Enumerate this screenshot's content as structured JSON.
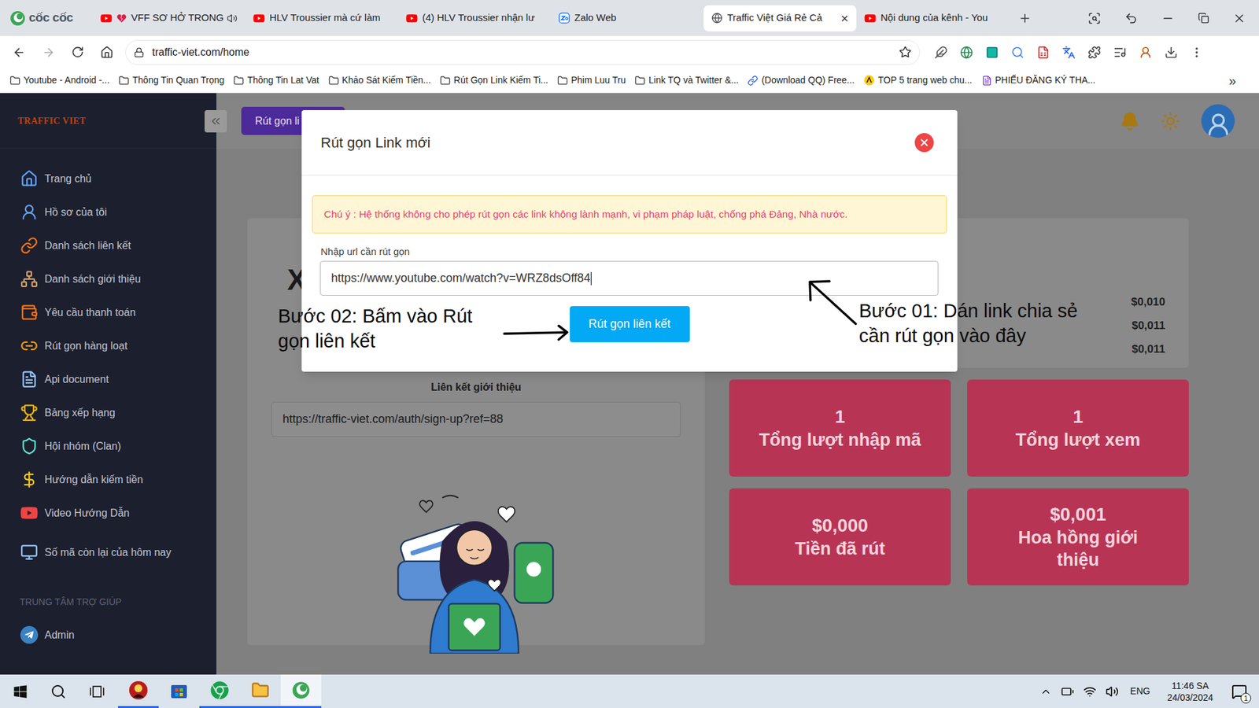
{
  "browser": {
    "brand": "cốc cốc",
    "tabs": [
      {
        "label": "VFF SƠ HỞ TRONG",
        "kind": "youtube",
        "selected": false,
        "audio": true,
        "heart": true
      },
      {
        "label": "HLV Troussier mà cứ làm",
        "kind": "youtube",
        "selected": false,
        "audio": false,
        "heart": false
      },
      {
        "label": "(4) HLV Troussier nhận lư",
        "kind": "youtube",
        "selected": false,
        "audio": false,
        "heart": false
      },
      {
        "label": "Zalo Web",
        "kind": "zalo",
        "selected": false,
        "audio": false,
        "heart": false
      },
      {
        "label": "Traffic Việt Giá Rẻ Cả",
        "kind": "globe",
        "selected": true,
        "audio": false,
        "heart": false
      },
      {
        "label": "Nội dung của kênh - You",
        "kind": "youtube",
        "selected": false,
        "audio": false,
        "heart": false
      }
    ],
    "close": "×",
    "address": "traffic-viet.com/home",
    "bookmarks": [
      {
        "label": "Youtube - Android -...",
        "kind": "folder"
      },
      {
        "label": "Thông Tin Quan Trọng",
        "kind": "folder"
      },
      {
        "label": "Thông Tin Lat Vat",
        "kind": "folder"
      },
      {
        "label": "Khảo Sát Kiếm Tiền...",
        "kind": "folder"
      },
      {
        "label": "Rút Gọn Link Kiếm Ti...",
        "kind": "folder"
      },
      {
        "label": "Phim Luu Tru",
        "kind": "folder"
      },
      {
        "label": "Link TQ và Twitter &...",
        "kind": "folder"
      },
      {
        "label": "(Download QQ) Free...",
        "kind": "link"
      },
      {
        "label": "TOP 5 trang web chu...",
        "kind": "star"
      },
      {
        "label": "PHIẾU ĐĂNG KÝ THA...",
        "kind": "form"
      }
    ],
    "bookmarks_more": "»"
  },
  "sidebar": {
    "logo": "TRAFFIC VIET",
    "items": [
      {
        "label": "Trang chủ",
        "selected": false
      },
      {
        "label": "Hồ sơ của tôi",
        "selected": false
      },
      {
        "label": "Danh sách liên kết",
        "selected": false
      },
      {
        "label": "Danh sách giới thiệu",
        "selected": false
      },
      {
        "label": "Yêu cầu thanh toán",
        "selected": false
      },
      {
        "label": "Rút gọn hàng loạt",
        "selected": false
      },
      {
        "label": "Api document",
        "selected": false
      },
      {
        "label": "Bảng xếp hạng",
        "selected": false
      },
      {
        "label": "Hội nhóm (Clan)",
        "selected": false
      },
      {
        "label": "Hướng dẫn kiếm tiền",
        "selected": false
      },
      {
        "label": "Video Hướng Dẫn",
        "selected": false
      },
      {
        "label": "Số mã còn lại của hôm nay",
        "selected": false
      }
    ],
    "section": "TRUNG TÂM TRỢ GIÚP",
    "help_items": [
      {
        "label": "Admin",
        "selected": false
      }
    ]
  },
  "topbar": {
    "button": "Rút gọn li"
  },
  "main": {
    "big_letter": "X",
    "referral_label": "Liên kết giới thiệu",
    "referral_link": "https://traffic-viet.com/auth/sign-up?ref=88",
    "rates": [
      "$0,010",
      "$0,011",
      "$0,011"
    ],
    "stats": [
      {
        "value": "1",
        "label_lines": [
          "Tổng lượt nhập mã"
        ]
      },
      {
        "value": "1",
        "label_lines": [
          "Tổng lượt xem"
        ]
      },
      {
        "value": "$0,000",
        "label_lines": [
          "Tiền đã rút"
        ]
      },
      {
        "value": "$0,001",
        "label_lines": [
          "Hoa hồng giới",
          "thiệu"
        ]
      }
    ]
  },
  "modal": {
    "title": "Rút gọn Link mới",
    "warning": "Chú ý : Hệ thống không cho phép rút gọn các link không lành mạnh, vi phạm pháp luật, chống phá Đảng, Nhà nước.",
    "input_label": "Nhập url cần rút gọn",
    "input_value": "https://www.youtube.com/watch?v=WRZ8dsOff84",
    "focused": true,
    "submit": "Rút gọn liên kết"
  },
  "annotations": [
    {
      "lines": [
        "Bước 02: Bấm vào Rút",
        "gọn liên kết"
      ]
    },
    {
      "lines": [
        "Bước 01: Dán link chia sẻ",
        "cần rút gọn vào đây"
      ]
    }
  ],
  "taskbar": {
    "apps": [
      {
        "kind": "game",
        "running": true,
        "active": false
      },
      {
        "kind": "store",
        "running": false,
        "active": false
      },
      {
        "kind": "chrome",
        "running": true,
        "active": false
      },
      {
        "kind": "folder",
        "running": true,
        "active": false
      },
      {
        "kind": "coccoc",
        "running": true,
        "active": true
      }
    ],
    "language": "ENG",
    "time": "11:46 SA",
    "date": "24/03/2024",
    "notifications": "1"
  }
}
